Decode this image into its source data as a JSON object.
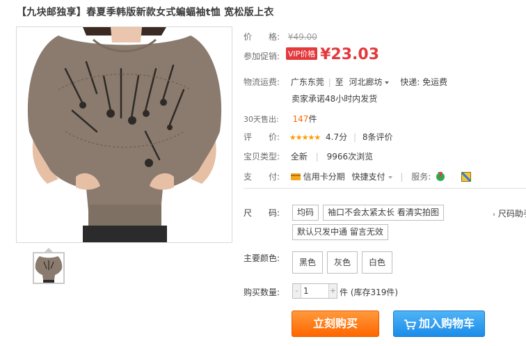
{
  "product": {
    "title": "【九块邮独享】春夏季韩版新款女式蝙蝠袖t恤 宽松版上衣"
  },
  "price": {
    "label": "价　　格:",
    "original": "¥49.00",
    "promo_label": "参加促销:",
    "vip_badge": "VIP价格",
    "currency": "¥",
    "value": "23.03"
  },
  "shipping": {
    "label": "物流运费:",
    "from": "广东东莞",
    "to_sep": "至",
    "to": "河北廊坊",
    "method": "快递: 免运费",
    "promise": "卖家承诺48小时内发货"
  },
  "sales": {
    "label": "30天售出:",
    "count": "147",
    "unit": "件"
  },
  "rating": {
    "label": "评　　价:",
    "stars": "★★★★★",
    "score": "4.7分",
    "reviews": "8条评价"
  },
  "type": {
    "label": "宝贝类型:",
    "condition": "全新",
    "views": "9966次浏览"
  },
  "payment": {
    "label": "支　　付:",
    "credit": "信用卡分期",
    "quick": "快捷支付",
    "service_label": "服务:"
  },
  "size": {
    "label": "尺　　码:",
    "options": [
      "均码",
      "袖口不会太紧太长 看清实拍图",
      "默认只发中通 留言无效"
    ],
    "helper": "尺码助手"
  },
  "color": {
    "label": "主要颜色:",
    "options": [
      "黑色",
      "灰色",
      "白色"
    ]
  },
  "quantity": {
    "label": "购买数量:",
    "minus": "-",
    "value": "1",
    "plus": "+",
    "unit": "件",
    "stock": "(库存319件)"
  },
  "actions": {
    "buy": "立刻购买",
    "cart": "加入购物车"
  },
  "colors": {
    "accent_red": "#e4393c",
    "orange": "#ff6600",
    "blue": "#1c8ce8",
    "shirt": "#8a7b6e"
  }
}
